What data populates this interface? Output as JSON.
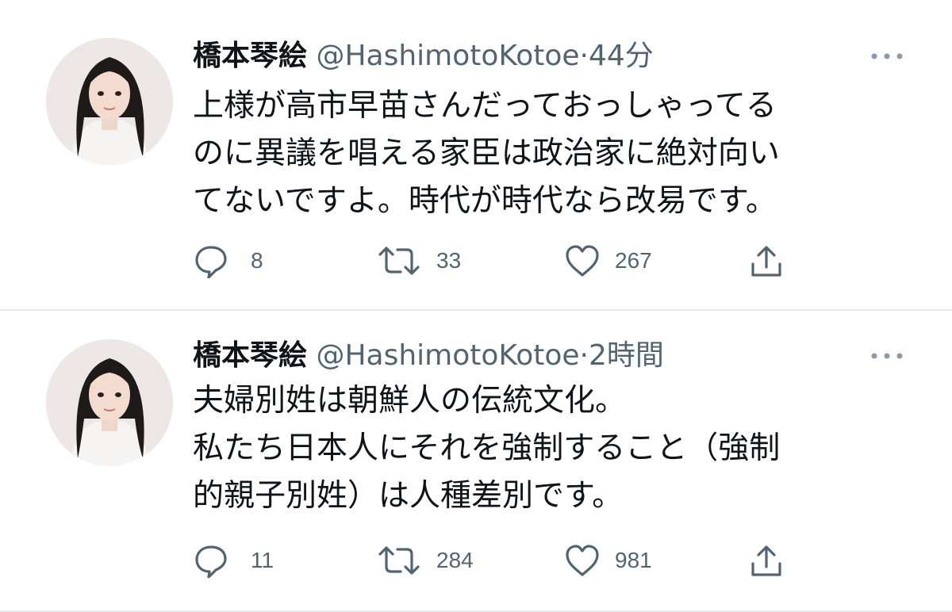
{
  "tweets": [
    {
      "display_name": "橋本琴絵",
      "handle": "@HashimotoKotoe",
      "separator": "·",
      "time": "44分",
      "text": "上様が高市早苗さんだっておっしゃってる\nのに異議を唱える家臣は政治家に絶対向い\nてないですよ。時代が時代なら改易です。",
      "reply_count": "8",
      "retweet_count": "33",
      "like_count": "267"
    },
    {
      "display_name": "橋本琴絵",
      "handle": "@HashimotoKotoe",
      "separator": "·",
      "time": "2時間",
      "text": "夫婦別姓は朝鮮人の伝統文化。\n私たち日本人にそれを強制すること（強制\n的親子別姓）は人種差別です。",
      "reply_count": "11",
      "retweet_count": "284",
      "like_count": "981"
    }
  ],
  "icons": {
    "reply": "reply-icon",
    "retweet": "retweet-icon",
    "like": "heart-icon",
    "share": "share-icon",
    "more": "more-icon"
  },
  "colors": {
    "text": "#0f1419",
    "secondary": "#536471",
    "divider": "#e6ecf0"
  }
}
